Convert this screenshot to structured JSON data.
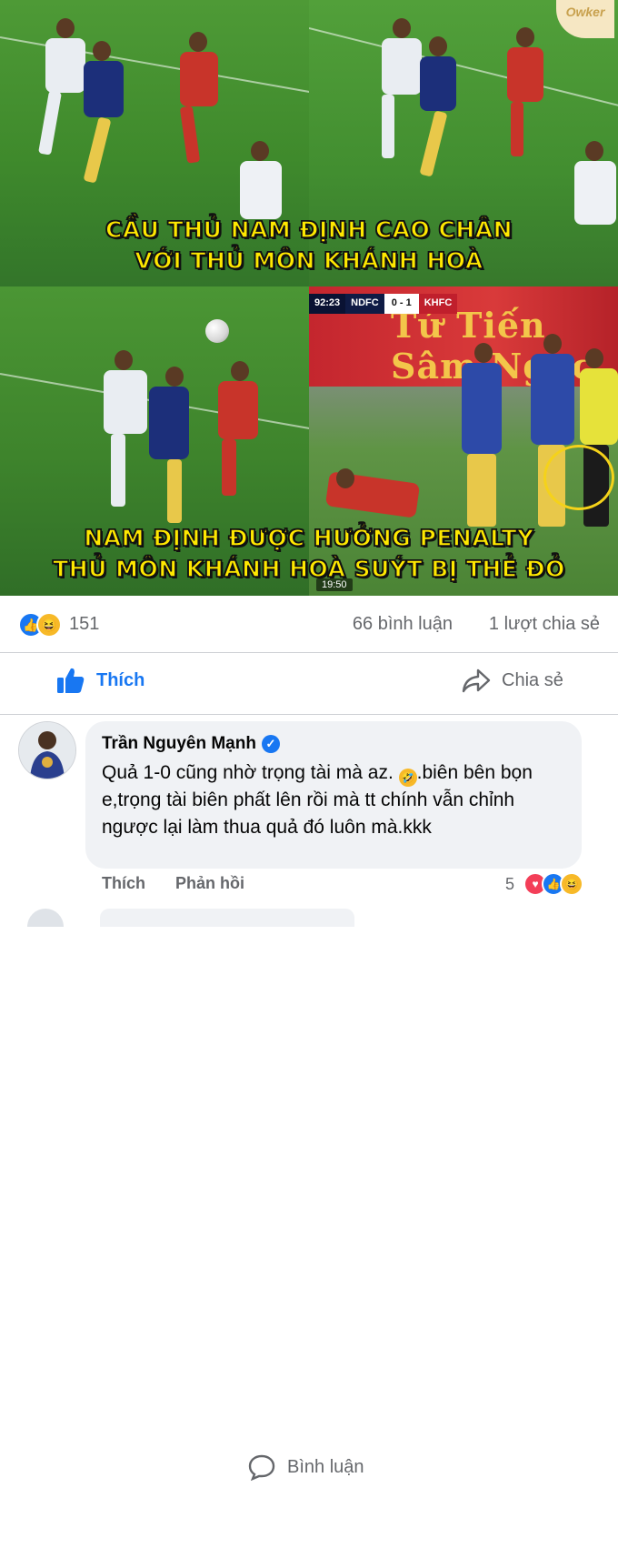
{
  "media": {
    "watermark": "Owker",
    "caption_top_line1": "CẦU THỦ NAM ĐỊNH CAO CHÂN",
    "caption_top_line2": "VỚI THỦ MÔN KHÁNH HOÀ",
    "caption_bottom_line1": "NAM ĐỊNH ĐƯỢC HƯỞNG PENALTY",
    "caption_bottom_line2": "THỦ MÔN KHÁNH HOÀ SUÝT BỊ THẺ ĐỎ",
    "scorebug_time": "92:23",
    "scorebug_home": "NDFC",
    "scorebug_score": "0 - 1",
    "scorebug_away": "KHFC",
    "board_text": "Tứ Tiến Sâm Ngọc Linh",
    "timecode": "19:50",
    "colors": {
      "caption_yellow": "#ffe800",
      "highlight_circle": "#f5d21a"
    }
  },
  "reactions": {
    "count": "151",
    "comments": "66 bình luận",
    "shares": "1 lượt chia sẻ",
    "icons": [
      "like-icon",
      "haha-icon"
    ]
  },
  "actions": {
    "like_label": "Thích",
    "comment_label": "Bình luận",
    "share_label": "Chia sẻ",
    "accent": "#1877f2"
  },
  "comment": {
    "author": "Trần Nguyên Mạnh",
    "verified": true,
    "text_part1": "Quả 1-0 cũng nhờ trọng tài mà az. ",
    "text_part2": ".biên bên bọn e,trọng tài biên phất lên rồi mà tt chính vẫn chỉnh ngược lại làm thua quả đó luôn mà.kkk",
    "like_action": "Thích",
    "reply_action": "Phản hồi",
    "reaction_count": "5"
  }
}
